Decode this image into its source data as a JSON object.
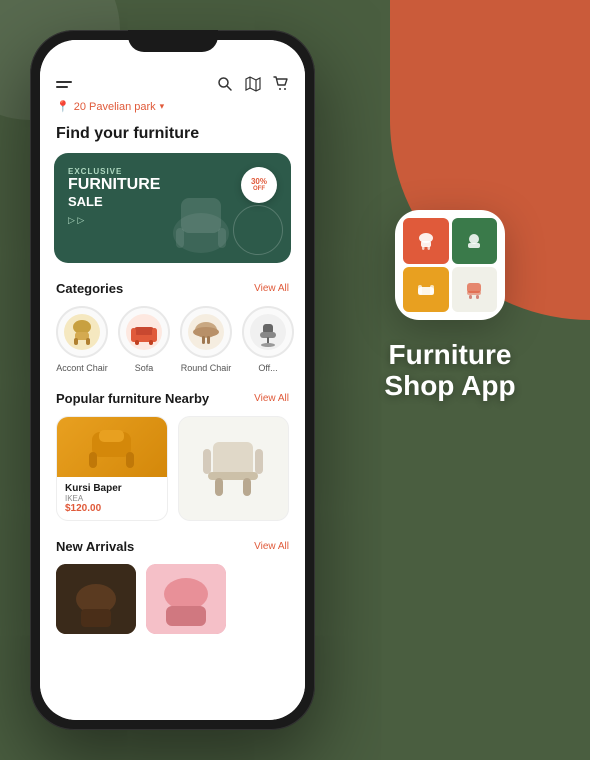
{
  "app": {
    "name": "Furniture",
    "name2": "Shop App"
  },
  "phone": {
    "header": {
      "search_icon": "search",
      "map_icon": "map",
      "cart_icon": "cart"
    },
    "location": {
      "text": "20 Pavelian park",
      "icon": "pin"
    },
    "hero_title": "Find your furniture",
    "banner": {
      "tag": "EXCLUSIVE",
      "title": "FURNITURE",
      "subtitle": "SALE",
      "discount": "30%",
      "off_label": "OFF"
    },
    "categories": {
      "label": "Categories",
      "view_all": "View All",
      "items": [
        {
          "id": "accent-chair",
          "label": "Accont Chair"
        },
        {
          "id": "sofa",
          "label": "Sofa"
        },
        {
          "id": "round-chair",
          "label": "Round Chair"
        },
        {
          "id": "office-chair",
          "label": "Off..."
        }
      ]
    },
    "popular": {
      "label": "Popular furniture Nearby",
      "view_all": "View All",
      "items": [
        {
          "name": "Kursi Baper",
          "brand": "IKEA",
          "price": "$120.00"
        }
      ]
    },
    "new_arrivals": {
      "label": "New Arrivals",
      "view_all": "View All"
    }
  }
}
